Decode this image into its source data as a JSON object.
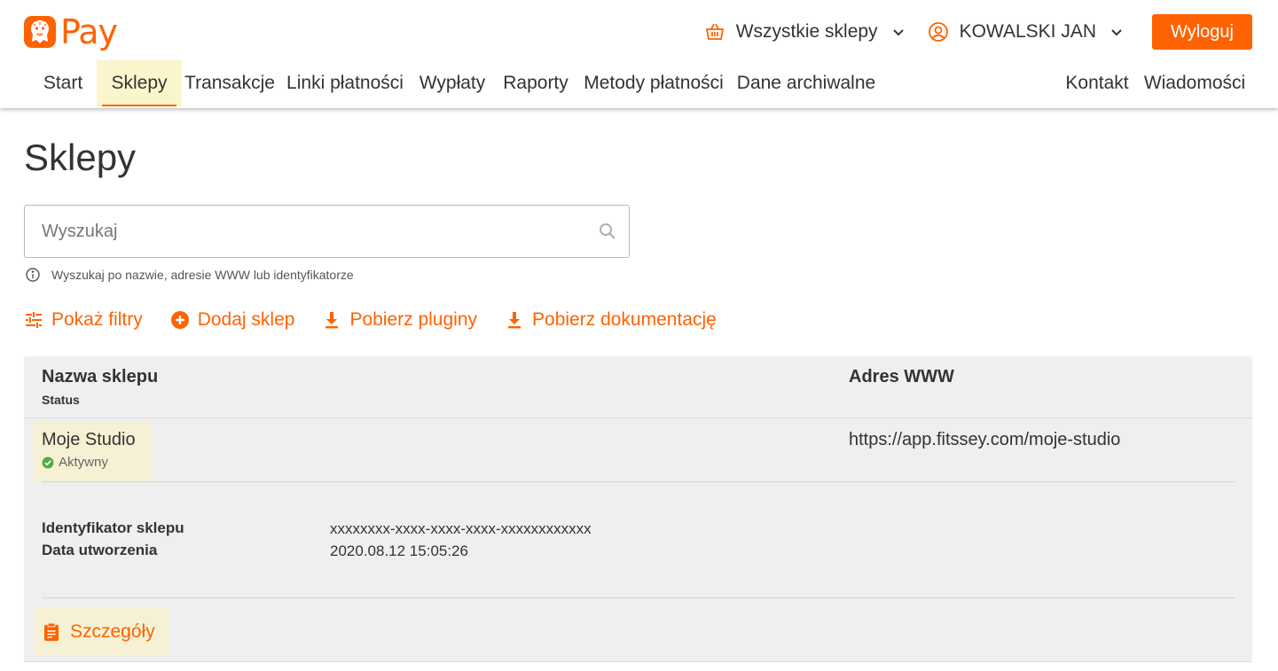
{
  "brand": {
    "logo_text": "Pay",
    "accent_color": "#ff6200"
  },
  "header": {
    "shop_selector": {
      "label": "Wszystkie sklepy",
      "icon": "basket-icon"
    },
    "user_menu": {
      "label": "KOWALSKI JAN",
      "icon": "user-circle-icon"
    },
    "logout_label": "Wyloguj"
  },
  "nav": {
    "items": [
      {
        "label": "Start",
        "active": false
      },
      {
        "label": "Sklepy",
        "active": true
      },
      {
        "label": "Transakcje",
        "active": false
      },
      {
        "label": "Linki płatności",
        "active": false
      },
      {
        "label": "Wypłaty",
        "active": false
      },
      {
        "label": "Raporty",
        "active": false
      },
      {
        "label": "Metody płatności",
        "active": false
      },
      {
        "label": "Dane archiwalne",
        "active": false
      }
    ],
    "right_items": [
      {
        "label": "Kontakt"
      },
      {
        "label": "Wiadomości"
      }
    ]
  },
  "page": {
    "title": "Sklepy",
    "search": {
      "placeholder": "Wyszukaj",
      "value": "",
      "hint": "Wyszukaj po nazwie, adresie WWW lub identyfikatorze"
    },
    "actions": [
      {
        "label": "Pokaż filtry",
        "icon": "filter-sliders-icon"
      },
      {
        "label": "Dodaj sklep",
        "icon": "plus-circle-icon"
      },
      {
        "label": "Pobierz pluginy",
        "icon": "download-icon"
      },
      {
        "label": "Pobierz dokumentację",
        "icon": "download-icon"
      }
    ]
  },
  "table": {
    "headers": {
      "name": "Nazwa sklepu",
      "status": "Status",
      "www": "Adres WWW"
    },
    "rows": [
      {
        "name": "Moje Studio",
        "status": "Aktywny",
        "status_color": "#5aa646",
        "www": "https://app.fitssey.com/moje-studio",
        "details": {
          "id_label": "Identyfikator sklepu",
          "id_value": "xxxxxxxx-xxxx-xxxx-xxxx-xxxxxxxxxxxx",
          "created_label": "Data utworzenia",
          "created_value": "2020.08.12 15:05:26"
        },
        "details_button": "Szczegóły"
      }
    ]
  }
}
